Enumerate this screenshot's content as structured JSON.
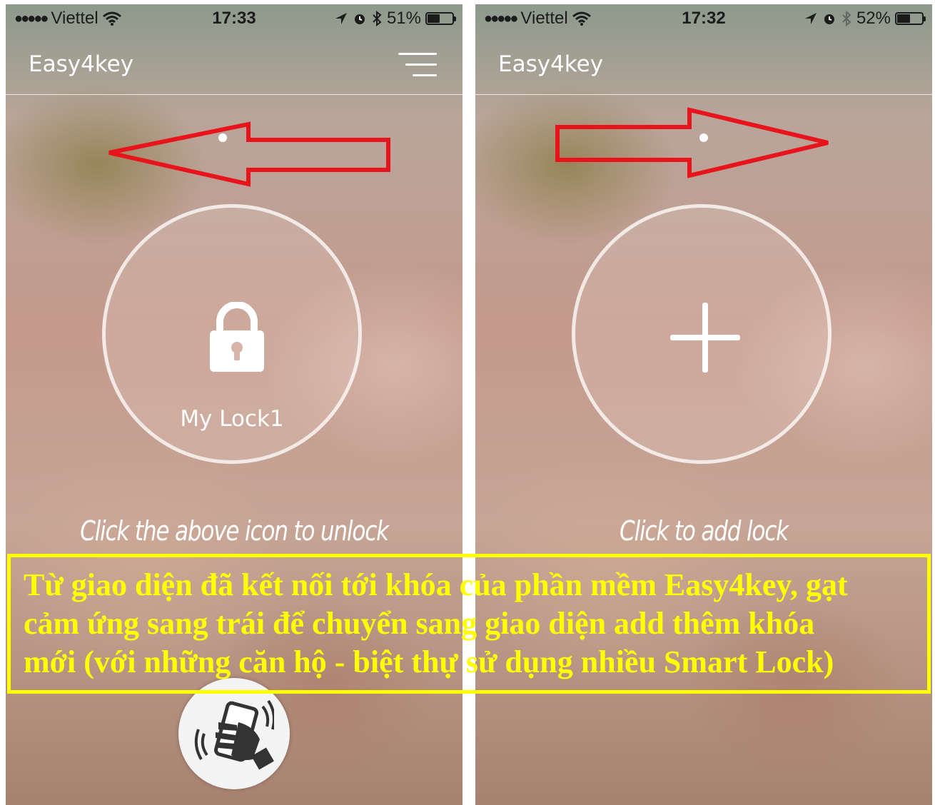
{
  "status_left": {
    "carrier": "Viettel",
    "time": "17:33",
    "battery_text": "51%",
    "battery_level": 0.51
  },
  "status_right": {
    "carrier": "Viettel",
    "time": "17:32",
    "battery_text": "52%",
    "battery_level": 0.52
  },
  "app": {
    "title": "Easy4key"
  },
  "left_screen": {
    "lock_name": "My Lock1",
    "hint": "Click the above icon to unlock"
  },
  "right_screen": {
    "hint": "Click to add lock"
  },
  "caption": {
    "line1": "Từ giao diện đã kết nối tới khóa của phần mềm Easy4key, gạt",
    "line2": "cảm ứng sang trái để chuyển sang giao diện add thêm khóa",
    "line3": "mới (với những căn hộ - biệt thự sử dụng nhiều Smart Lock)"
  },
  "colors": {
    "annotation_arrow": "#e8141c",
    "caption_text": "#ffff00",
    "caption_border": "#ffff00"
  },
  "icons": [
    "signal-dots-icon",
    "wifi-icon",
    "location-arrow-icon",
    "alarm-icon",
    "bluetooth-icon",
    "battery-icon",
    "hamburger-menu-icon",
    "padlock-icon",
    "plus-icon",
    "nfc-phone-hand-icon",
    "swipe-left-arrow-icon",
    "swipe-right-arrow-icon"
  ]
}
